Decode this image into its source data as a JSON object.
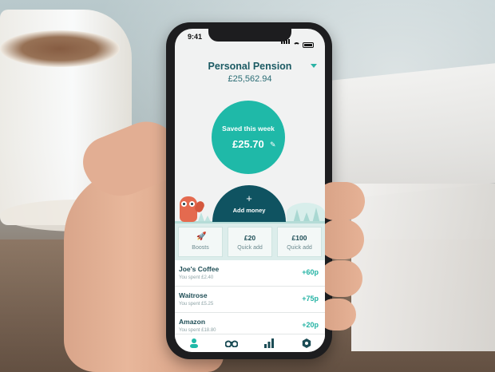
{
  "status_bar": {
    "time": "9:41"
  },
  "account": {
    "name": "Personal Pension",
    "balance": "£25,562.94"
  },
  "saved": {
    "label": "Saved this week",
    "amount": "£25.70"
  },
  "add_money": {
    "label": "Add money"
  },
  "quick_actions": [
    {
      "top": "",
      "label": "Boosts",
      "icon": "rocket-icon"
    },
    {
      "top": "£20",
      "label": "Quick add"
    },
    {
      "top": "£100",
      "label": "Quick add"
    }
  ],
  "transactions": [
    {
      "merchant": "Joe's Coffee",
      "spent": "You spent £2.40",
      "roundup": "+60p"
    },
    {
      "merchant": "Waitrose",
      "spent": "You spent £5.25",
      "roundup": "+75p"
    },
    {
      "merchant": "Amazon",
      "spent": "You spent £18.80",
      "roundup": "+20p"
    }
  ],
  "tabs": [
    "person-icon",
    "binoculars-icon",
    "bar-chart-icon",
    "settings-hex-icon"
  ],
  "colors": {
    "accent": "#1fb9a8",
    "dark_teal": "#0f5361",
    "owl": "#e46a4f"
  }
}
